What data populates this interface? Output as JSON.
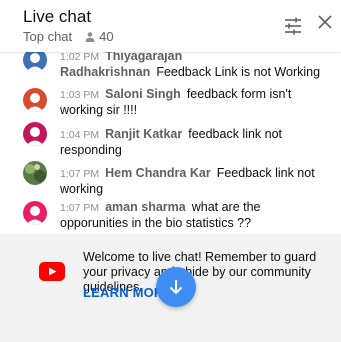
{
  "header": {
    "title": "Live chat",
    "mode": "Top chat",
    "viewer_count": "40"
  },
  "messages": [
    {
      "time": "1:02 PM",
      "author": "Thiyagarajan Radhakrishnan",
      "text": "Feedback Link is not Working",
      "avatar_color": "#3f6fb6"
    },
    {
      "time": "1:03 PM",
      "author": "Saloni Singh",
      "text": "feedback form isn't working sir !!!!",
      "avatar_color": "#d84b2f"
    },
    {
      "time": "1:04 PM",
      "author": "Ranjit Katkar",
      "text": "feedback link not responding",
      "avatar_color": "#c2185b"
    },
    {
      "time": "1:07 PM",
      "author": "Hem Chandra Kar",
      "text": "Feedback link not working",
      "avatar_color": "#5a7a4a"
    },
    {
      "time": "1:07 PM",
      "author": "aman sharma",
      "text": "what are the opporunities in the bio statistics ??",
      "avatar_color": "#e91e63"
    }
  ],
  "welcome": {
    "text": "Welcome to live chat! Remember to guard your privacy and abide by our community guidelines.",
    "learn_more": "LEARN MORE"
  },
  "colors": {
    "accent": "#065fd4",
    "scroll_button": "#3e8df3",
    "youtube_red": "#ff0000"
  }
}
